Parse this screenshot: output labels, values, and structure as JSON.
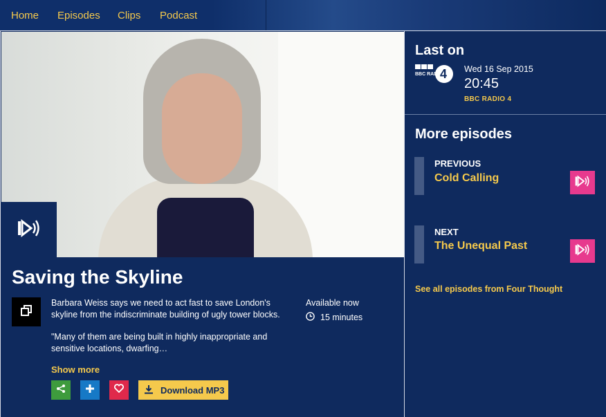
{
  "nav": {
    "items": [
      "Home",
      "Episodes",
      "Clips",
      "Podcast"
    ]
  },
  "episode": {
    "title": "Saving the Skyline",
    "description": "Barbara Weiss says we need to act fast to save London's skyline from the indiscriminate building of ugly tower blocks.",
    "quote": "\"Many of them are being built in highly inappropriate and sensitive locations, dwarfing…",
    "show_more": "Show more",
    "availability": "Available now",
    "duration": "15 minutes",
    "download_label": "Download MP3"
  },
  "last_on": {
    "heading": "Last on",
    "logo_text": "BBC RADIO",
    "logo_number": "4",
    "date": "Wed 16 Sep 2015",
    "time": "20:45",
    "station": "BBC RADIO 4"
  },
  "more_episodes": {
    "heading": "More episodes",
    "previous": {
      "kind": "PREVIOUS",
      "title": "Cold Calling"
    },
    "next": {
      "kind": "NEXT",
      "title": "The Unequal Past"
    },
    "see_all": "See all episodes from Four Thought"
  },
  "colors": {
    "background": "#0f2a5e",
    "accent_yellow": "#f5c94c",
    "share_green": "#3e9b3d",
    "add_blue": "#1679c6",
    "fav_red": "#e0294b",
    "play_pink": "#e73a8e"
  },
  "icons": {
    "hero_play": "iplayer-radio-play-icon",
    "expand": "expand-icon",
    "share": "share-icon",
    "add": "plus-icon",
    "favourite": "heart-icon",
    "download": "download-icon",
    "clock": "clock-icon"
  }
}
